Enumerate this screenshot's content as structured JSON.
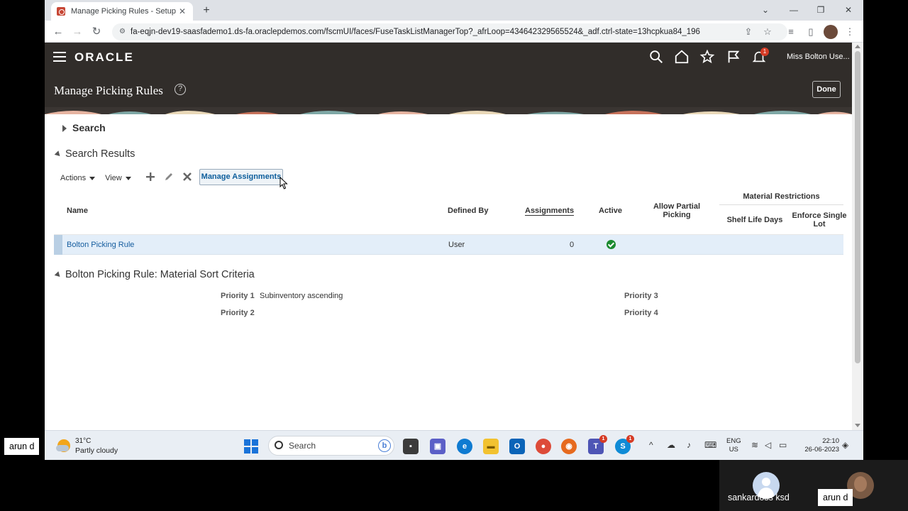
{
  "browser": {
    "tab_title": "Manage Picking Rules - Setup an",
    "url": "fa-eqjn-dev19-saasfademo1.ds-fa.oraclepdemos.com/fscmUI/faces/FuseTaskListManagerTop?_afrLoop=434642329565524&_adf.ctrl-state=13hcpkua84_196"
  },
  "app": {
    "logo": "ORACLE",
    "user_name": "Miss Bolton Use...",
    "notification_count": "1",
    "page_title": "Manage Picking Rules",
    "help_glyph": "?",
    "done_label": "Done"
  },
  "search": {
    "section_label": "Search"
  },
  "results": {
    "section_label": "Search Results",
    "actions_label": "Actions",
    "view_label": "View",
    "manage_assignments_label": "Manage Assignments",
    "columns": {
      "name": "Name",
      "defined_by": "Defined By",
      "assignments": "Assignments",
      "active": "Active",
      "allow_partial_1": "Allow Partial",
      "allow_partial_2": "Picking",
      "material_restrictions": "Material Restrictions",
      "shelf_life_days": "Shelf Life Days",
      "enforce_single_1": "Enforce Single",
      "enforce_single_2": "Lot"
    },
    "rows": [
      {
        "name": "Bolton Picking Rule",
        "defined_by": "User",
        "assignments": "0",
        "active": true
      }
    ]
  },
  "criteria": {
    "section_label": "Bolton Picking Rule: Material Sort Criteria",
    "priority1_label": "Priority 1",
    "priority1_value": "Subinventory ascending",
    "priority2_label": "Priority 2",
    "priority3_label": "Priority 3",
    "priority4_label": "Priority 4"
  },
  "taskbar": {
    "temperature": "31°C",
    "weather": "Partly cloudy",
    "search_placeholder": "Search",
    "lang_1": "ENG",
    "lang_2": "US",
    "time": "22:10",
    "date": "26-06-2023",
    "teams_badge": "1",
    "skype_badge": "1"
  },
  "call": {
    "presenter_chip": "arun d",
    "participant1": "sankardoss ksd",
    "participant2": "arun d"
  },
  "colors": {
    "header_bg": "#312d2a",
    "link": "#145c9e",
    "selected_row": "#e3eef9",
    "active_check": "#1b8a2f"
  }
}
